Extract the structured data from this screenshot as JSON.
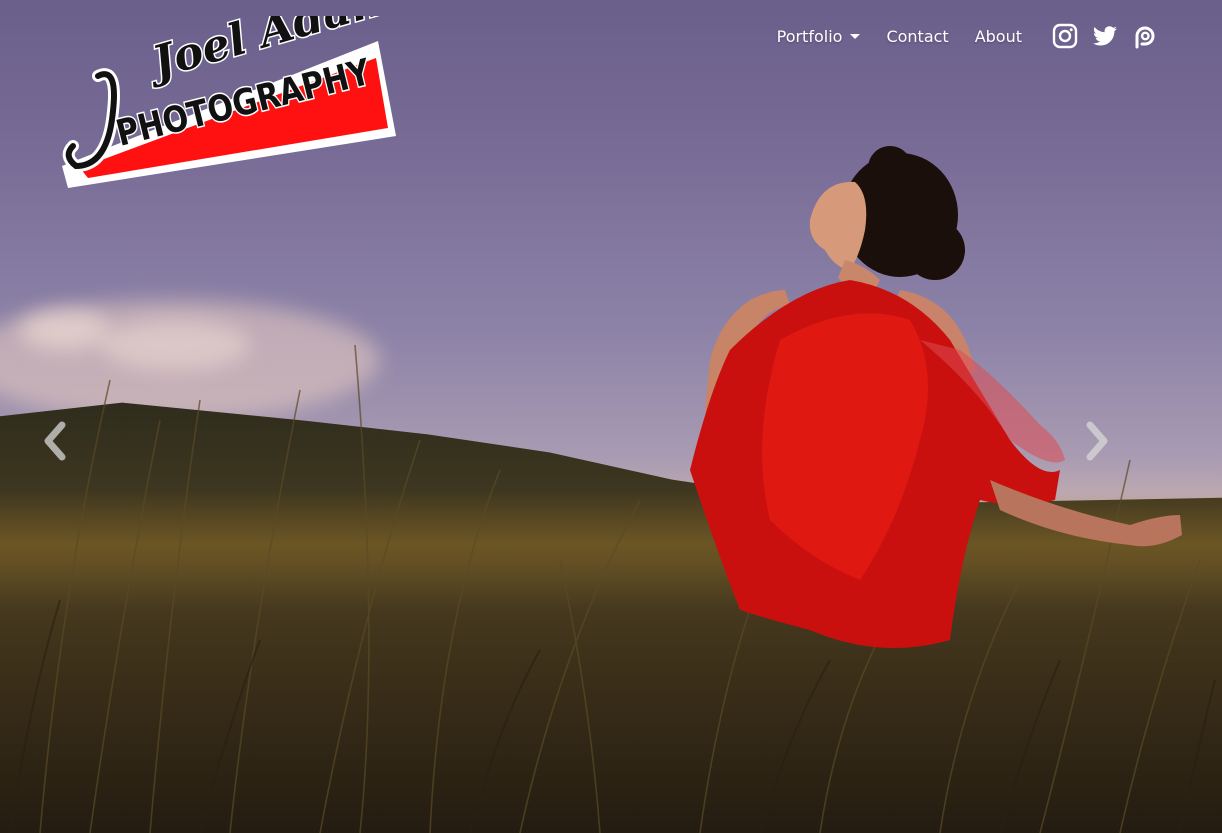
{
  "brand": {
    "logo_line1": "Joel Adams",
    "logo_line2": "PHOTOGRAPHY",
    "colors": {
      "red": "#ff1111",
      "black": "#111111",
      "white": "#ffffff"
    }
  },
  "nav": {
    "items": [
      {
        "label": "Portfolio",
        "has_dropdown": true
      },
      {
        "label": "Contact"
      },
      {
        "label": "About"
      }
    ],
    "social": [
      {
        "icon": "instagram-icon"
      },
      {
        "icon": "twitter-icon"
      },
      {
        "icon": "patreon-icon"
      }
    ]
  },
  "carousel": {
    "prev_icon": "chevron-left-icon",
    "next_icon": "chevron-right-icon"
  }
}
